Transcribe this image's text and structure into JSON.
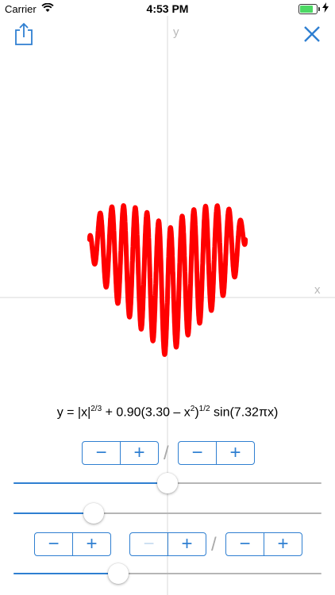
{
  "status_bar": {
    "carrier": "Carrier",
    "time": "4:53 PM",
    "battery_level": 0.9
  },
  "nav": {
    "share_icon": "share-icon",
    "close_icon": "close-icon",
    "accent_color": "#2f7fd1"
  },
  "graph": {
    "y_label": "y",
    "x_label": "x",
    "curve_color": "#ff0000",
    "axis_color": "#d9d9d9"
  },
  "equation": {
    "prefix": "y = |x|",
    "exp1": "2/3",
    "mid": " + 0.90(3.30 – x",
    "exp2": "2",
    "close": ")",
    "exp3": "1/2",
    "tail": " sin(7.32πx)"
  },
  "controls": {
    "stepper_minus": "−",
    "stepper_plus": "+",
    "slash": "/",
    "sliders": [
      {
        "value": 0.5
      },
      {
        "value": 0.26
      },
      {
        "value": 0.34
      }
    ]
  }
}
